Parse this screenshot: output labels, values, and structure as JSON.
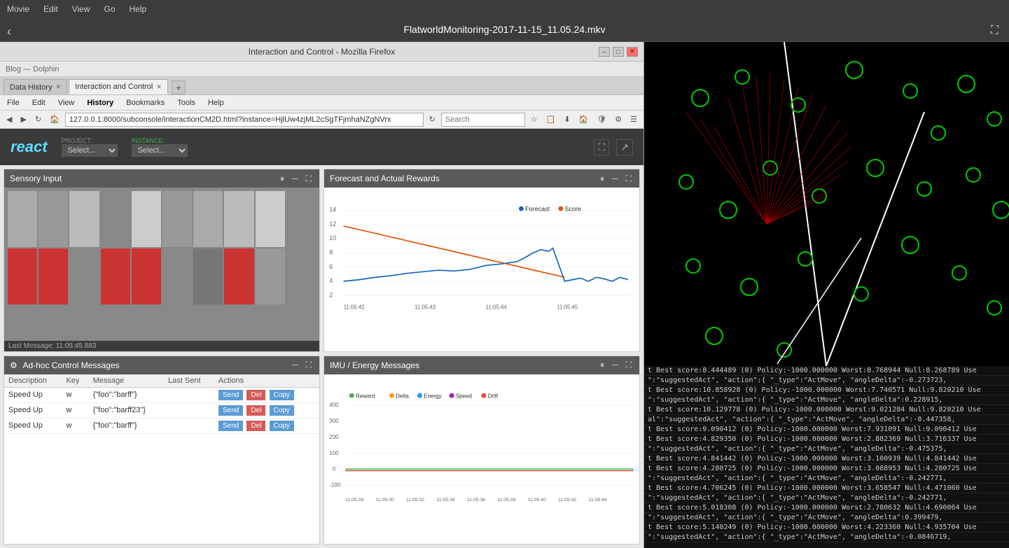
{
  "video_player": {
    "menu_items": [
      "Movie",
      "Edit",
      "View",
      "Go",
      "Help"
    ],
    "title": "FlatworldMonitoring-2017-11-15_11.05.24.mkv",
    "back_label": "‹",
    "expand_label": "⛶"
  },
  "browser": {
    "titlebar": "Interaction and Control - Mozilla Firefox",
    "dolphin_label": "Blog — Dolphin",
    "tabs": [
      {
        "label": "Data History",
        "active": false,
        "closeable": true
      },
      {
        "label": "Interaction and Control",
        "active": true,
        "closeable": true
      }
    ],
    "new_tab_label": "+",
    "address": "127.0.0.1:8000/subconsole/interactionCM2D.html?instance=HjlUw4zjML2cSgTFjmhaNZgNVrx",
    "search_placeholder": "Search",
    "menu_items": [
      "File",
      "Edit",
      "View",
      "History",
      "Bookmarks",
      "Tools",
      "Help"
    ]
  },
  "react_app": {
    "logo": "react",
    "project_label": "PROJECT:",
    "project_value": "Select...",
    "instance_label": "INSTANCE:",
    "instance_value": "Select..."
  },
  "sensory_panel": {
    "title": "Sensory Input",
    "last_message": "Last Message: 11:05:45.883"
  },
  "forecast_panel": {
    "title": "Forecast and Actual Rewards",
    "legend": [
      {
        "label": "Forecast",
        "color": "#1565c0"
      },
      {
        "label": "Score",
        "color": "#e65100"
      }
    ],
    "y_labels": [
      "14",
      "12",
      "10",
      "8",
      "6",
      "4",
      "2"
    ],
    "x_labels": [
      "11:05:42",
      "11:05:43",
      "11:05:44",
      "11:05:45"
    ]
  },
  "adhoc_panel": {
    "title": "Ad-hoc Control Messages",
    "columns": [
      "Description",
      "Key",
      "Message",
      "Last Sent",
      "Actions"
    ],
    "rows": [
      {
        "description": "Speed Up",
        "key": "w",
        "message": "{\"foo\":\"barff\"}",
        "last_sent": "",
        "actions": [
          "Send",
          "Del",
          "Copy"
        ]
      },
      {
        "description": "Speed Up",
        "key": "w",
        "message": "{\"foo\":\"barff23\"}",
        "last_sent": "",
        "actions": [
          "Send",
          "Del",
          "Copy"
        ]
      },
      {
        "description": "Speed Up",
        "key": "w",
        "message": "{\"foo\":\"barff\"}",
        "last_sent": "",
        "actions": [
          "Send",
          "Del",
          "Copy"
        ]
      }
    ]
  },
  "imu_panel": {
    "title": "IMU / Energy Messages",
    "legend": [
      {
        "label": "Reward",
        "color": "#4caf50"
      },
      {
        "label": "Delta",
        "color": "#ff9800"
      },
      {
        "label": "Energy",
        "color": "#2196f3"
      },
      {
        "label": "Speed",
        "color": "#9c27b0"
      },
      {
        "label": "Drift",
        "color": "#f44336"
      }
    ],
    "y_labels": [
      "400",
      "300",
      "200",
      "100",
      "0",
      "-100"
    ],
    "x_labels": [
      "11:05:28",
      "11:05:30",
      "11:05:32",
      "11:05:34",
      "11:05:36",
      "11:05:38",
      "11:05:40",
      "11:05:42",
      "11:05:44"
    ]
  },
  "log_lines": [
    "t Best score:8.444489 (0) Policy:-1000.000000 Worst:8.768944 Null:8.268789  Use",
    "\":\"suggestedAct\", \"action\":{  \"_type\":\"ActMove\",  \"angleDelta\":-0.273723,",
    "t Best score:10.858928 (0) Policy:-1000.000000 Worst:7.740571 Null:9.820210  Use",
    "\":\"suggestedAct\", \"action\":{  \"_type\":\"ActMove\",  \"angleDelta\":0.228915,",
    "t Best score:10.129778 (0) Policy:-1000.000000 Worst:9.021284 Null:9.820210  Use",
    "al\":\"suggestedAct\", \"action\":{  \"_type\":\"ActMove\",  \"angleDelta\":-0.447358,",
    "t Best score:9.090412 (0) Policy:-1000.000000 Worst:7.931091 Null:9.090412  Use",
    "t Best score:4.829350 (0) Policy:-1000.000000 Worst:2.882369 Null:3.716337  Use",
    "\":\"suggestedAct\", \"action\":{  \"_type\":\"ActMove\",  \"angleDelta\":-0.475375,",
    "t Best score:4.841442 (0) Policy:-1000.000000 Worst:3.100939 Null:4.841442  Use",
    "t Best score:4.280725 (0) Policy:-1000.000000 Worst:3.088953 Null:4.280725  Use",
    "\":\"suggestedAct\", \"action\":{  \"_type\":\"ActMove\",  \"angleDelta\":-0.242771,",
    "t Best score:4.706245 (0) Policy:-1000.000000 Worst:3.658547 Null:4.471060  Use",
    "\":\"suggestedAct\", \"action\":{  \"_type\":\"ActMove\",  \"angleDelta\":-0.242771,",
    "t Best score:5.018308 (0) Policy:-1000.000000 Worst:2.780632 Null:4.690064  Use",
    "\":\"suggestedAct\", \"action\":{  \"_type\":\"ActMove\",  \"angleDelta\":0.399479,",
    "t Best score:5.140249 (0) Policy:-1000.000000 Worst:4.223360 Null:4.935704  Use",
    "\":\"suggestedAct\", \"action\":{  \"_type\":\"ActMove\",  \"angleDelta\":-0.0846719,"
  ]
}
